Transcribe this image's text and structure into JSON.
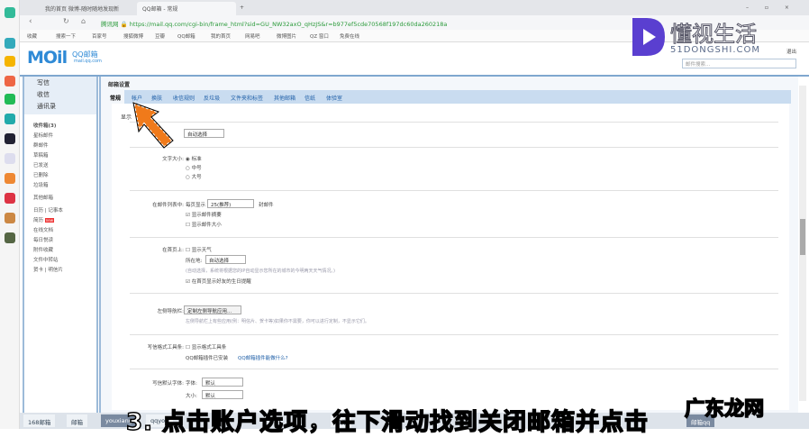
{
  "browser": {
    "tabs": [
      "我的首页 微博-随时随地发现新",
      "QQ邮箱 - 常规"
    ],
    "url": "https://mail.qq.com/cgi-bin/frame_html?sid=GU_NW32axO_qHzJS&r=b977ef5cde70568f197dc60da260218a",
    "secure_label": "腾讯网",
    "bookmarks": [
      "收藏",
      "搜索一下",
      "百家号",
      "搜狐微博",
      "豆瓣",
      "QQ邮箱",
      "我的首页",
      "网易吧",
      "微博图片",
      "QZ 窗口",
      "免费在线"
    ]
  },
  "mail": {
    "logo": "MOil",
    "logo_cn": "QQ邮箱",
    "logo_domain": "mail.qq.com",
    "search_placeholder": "邮件搜索...",
    "logout": "退出",
    "nav": {
      "top": [
        "写信",
        "收信",
        "通讯录"
      ],
      "folders": [
        "收件箱(3)",
        "星标邮件",
        "群邮件",
        "草稿箱",
        "已发送",
        "已删除",
        "垃圾箱"
      ],
      "other": "其他邮箱",
      "extras": [
        "日历 | 记事本",
        "简历",
        "在线文档",
        "每日悦读",
        "附件收藏",
        "文件中转站",
        "贺卡 | 明信片"
      ],
      "badge_new": "new"
    },
    "title": "邮箱设置",
    "tabs": [
      "常规",
      "帐户",
      "换肤",
      "收信规则",
      "反垃圾",
      "文件夹和标签",
      "其他邮箱",
      "信纸",
      "体验室"
    ],
    "section": "显示",
    "language_select": "自动选择",
    "font_size": {
      "label": "文字大小:",
      "options": [
        "标准",
        "中号",
        "大号"
      ]
    },
    "list": {
      "label": "在邮件列表中:",
      "per_page_prefix": "每页显示",
      "per_page": "25(推荐)",
      "per_page_suffix": "封邮件",
      "show_summary": "显示邮件摘要",
      "show_size": "显示邮件大小"
    },
    "home": {
      "label": "在首页上:",
      "show_weather": "显示天气",
      "location_label": "所在地:",
      "location": "自动选择",
      "note": "(自动选择，系统将根据您的IP自动显示您所在的城市的今明两天天气情况。)",
      "birthday": "在首页显示好友的生日提醒"
    },
    "leftnav": {
      "label": "左侧导航栏:",
      "button": "定制左侧导航应用...",
      "note": "左侧导航栏上有些应用(例：明信片、贺卡等)如果你不需要，你可以进行定制，不显示它们。"
    },
    "toolbar": {
      "label": "写信格式工具条:",
      "show": "显示格式工具条",
      "plugin": "QQ邮箱插件已安装",
      "plugin_link": "QQ邮箱插件能做什么?"
    },
    "default_font": {
      "label": "写信默认字体:",
      "font_label": "字体:",
      "font": "默认",
      "size_label": "大小:",
      "size": "默认"
    }
  },
  "bottom_tabs": [
    "168邮箱",
    "邮箱",
    "youxiang",
    "qqyou",
    "邮件",
    "邮箱qq"
  ],
  "subtitle": "3. 点击账户选项，往下滑动找到关闭邮箱并点击",
  "watermarks": [
    "懂视生活",
    "51DONGSHI.COM",
    "广东龙网"
  ],
  "colors": {
    "accent": "#2f8ad6",
    "arrow": "#f07a1a",
    "tabs_bg": "#c9dcf0"
  }
}
